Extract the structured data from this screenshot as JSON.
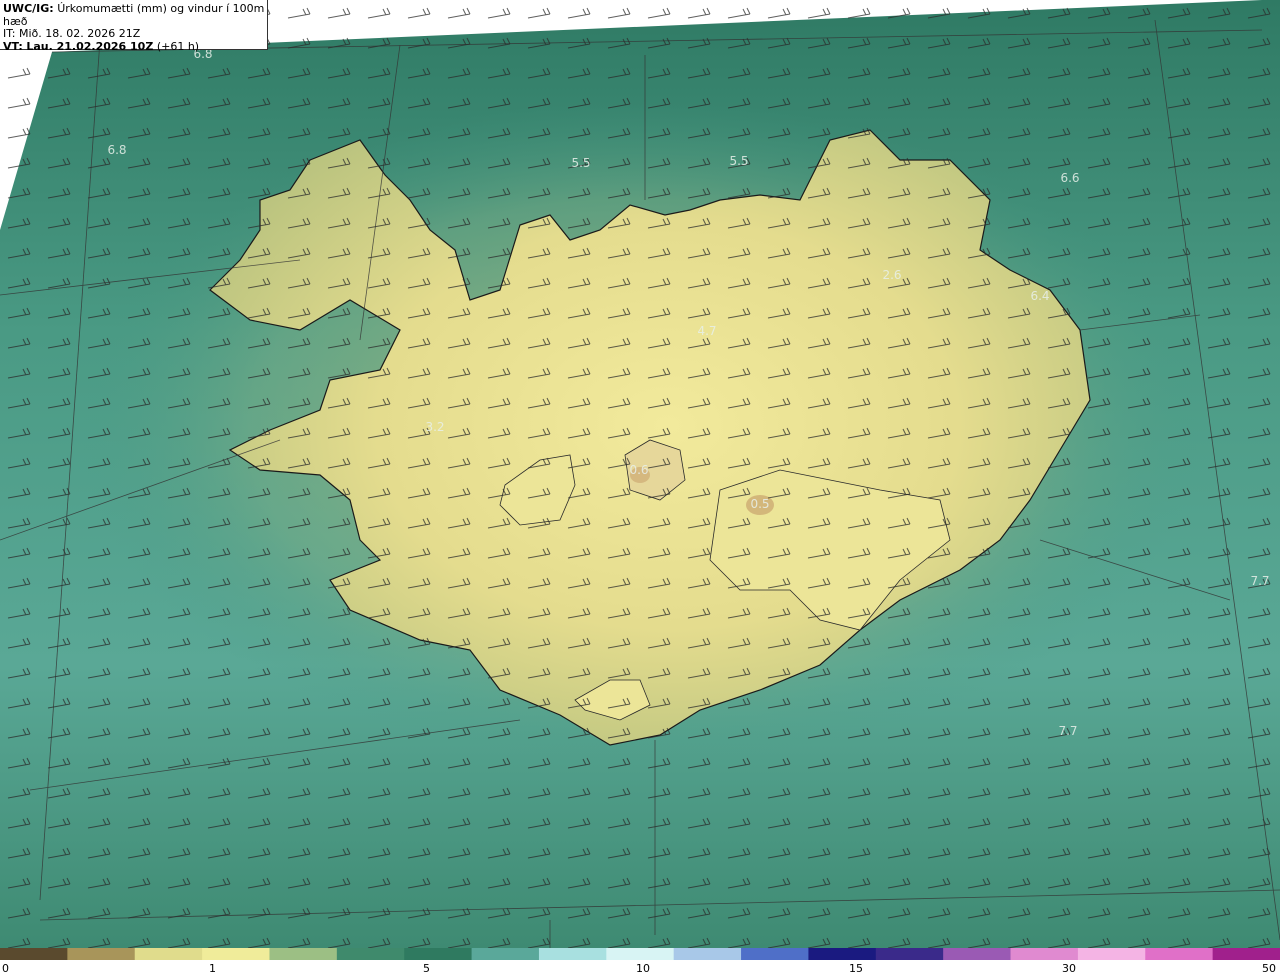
{
  "header": {
    "model_label": "UWC/IG:",
    "title": "Úrkomumætti (mm) og vindur í 100m hæð",
    "init_time": "IT: Mið. 18. 02. 2026 21Z",
    "valid_label": "VT:",
    "valid_time": "Lau. 21.02.2026 10Z",
    "lead_time": "(+61 h)"
  },
  "map_labels": [
    {
      "id": "lbl-68a",
      "text": "6.8"
    },
    {
      "id": "lbl-68b",
      "text": "6.8"
    },
    {
      "id": "lbl-55a",
      "text": "5.5"
    },
    {
      "id": "lbl-55b",
      "text": "5.5"
    },
    {
      "id": "lbl-66",
      "text": "6.6"
    },
    {
      "id": "lbl-64",
      "text": "6.4"
    },
    {
      "id": "lbl-26",
      "text": "2.6"
    },
    {
      "id": "lbl-47",
      "text": "4.7"
    },
    {
      "id": "lbl-32",
      "text": "3.2"
    },
    {
      "id": "lbl-06",
      "text": "0.6"
    },
    {
      "id": "lbl-05",
      "text": "0.5"
    },
    {
      "id": "lbl-77a",
      "text": "7.7"
    },
    {
      "id": "lbl-77b",
      "text": "7.7"
    }
  ],
  "colorbar": {
    "ticks": [
      "0",
      "1",
      "5",
      "10",
      "15",
      "30",
      "50"
    ],
    "colors": [
      "#5a4a2e",
      "#a8955a",
      "#e0dc8c",
      "#f0ec9a",
      "#9cbf84",
      "#3f8a6c",
      "#2f7a60",
      "#5aa89a",
      "#a8e0e0",
      "#d8f4f4",
      "#a8c8e8",
      "#4f6fc8",
      "#1a1a80",
      "#3a2a8a",
      "#9a5ab4",
      "#e08ad0",
      "#f4b4e4",
      "#e070c8",
      "#a0208c"
    ]
  },
  "colors": {
    "land": "#e8dc8a",
    "land_edge": "#c6c87e",
    "ocean_near": "#4f9a82",
    "ocean_far": "#2f7a64",
    "coastline": "#1a1a1a",
    "grid": "#333333"
  }
}
